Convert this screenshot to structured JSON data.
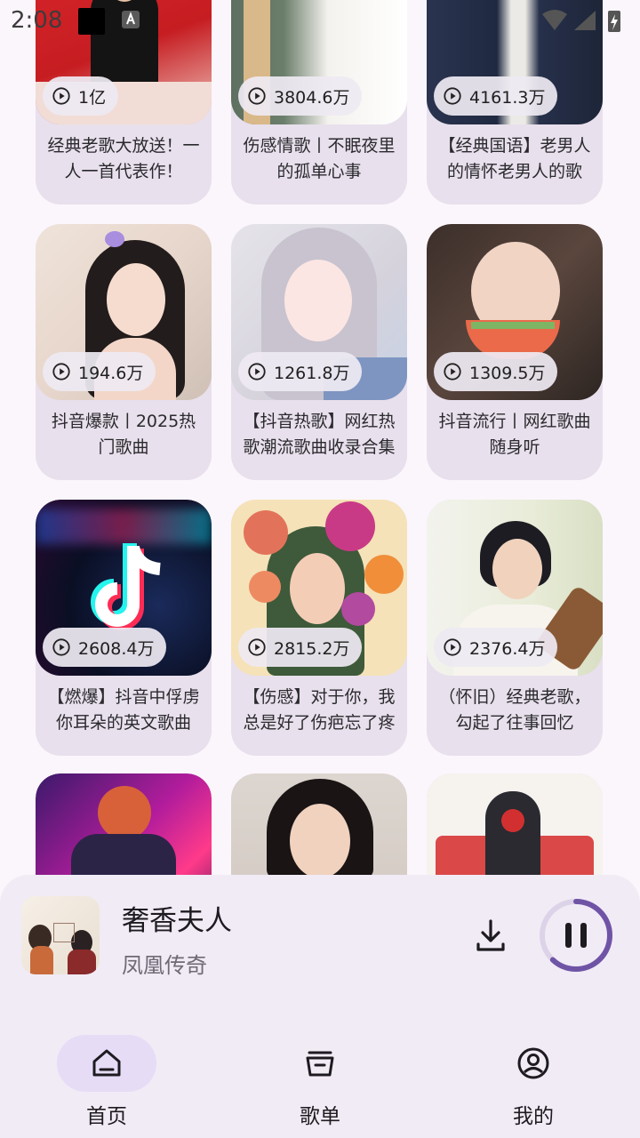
{
  "status_bar": {
    "time": "2:08"
  },
  "cards": [
    {
      "count": "1亿",
      "title": "经典老歌大放送！一人一首代表作！"
    },
    {
      "count": "3804.6万",
      "title": "伤感情歌丨不眠夜里的孤单心事"
    },
    {
      "count": "4161.3万",
      "title": "【经典国语】老男人的情怀老男人的歌"
    },
    {
      "count": "194.6万",
      "title": "抖音爆款丨2025热门歌曲"
    },
    {
      "count": "1261.8万",
      "title": "【抖音热歌】网红热歌潮流歌曲收录合集"
    },
    {
      "count": "1309.5万",
      "title": "抖音流行丨网红歌曲随身听"
    },
    {
      "count": "2608.4万",
      "title": "【燃爆】抖音中俘虏你耳朵的英文歌曲"
    },
    {
      "count": "2815.2万",
      "title": "【伤感】对于你，我总是好了伤疤忘了疼"
    },
    {
      "count": "2376.4万",
      "title": "（怀旧）经典老歌，勾起了往事回忆"
    }
  ],
  "now_playing": {
    "song": "奢香夫人",
    "artist": "凤凰传奇",
    "progress": 0.62
  },
  "nav": {
    "items": [
      {
        "label": "首页",
        "icon": "home-icon",
        "active": true
      },
      {
        "label": "歌单",
        "icon": "playlist-icon",
        "active": false
      },
      {
        "label": "我的",
        "icon": "profile-icon",
        "active": false
      }
    ]
  },
  "colors": {
    "accent": "#6f54a6",
    "nav_active": "#e6dcf6",
    "card_bg": "#e8e0ec",
    "background": "#fbf6fc"
  }
}
